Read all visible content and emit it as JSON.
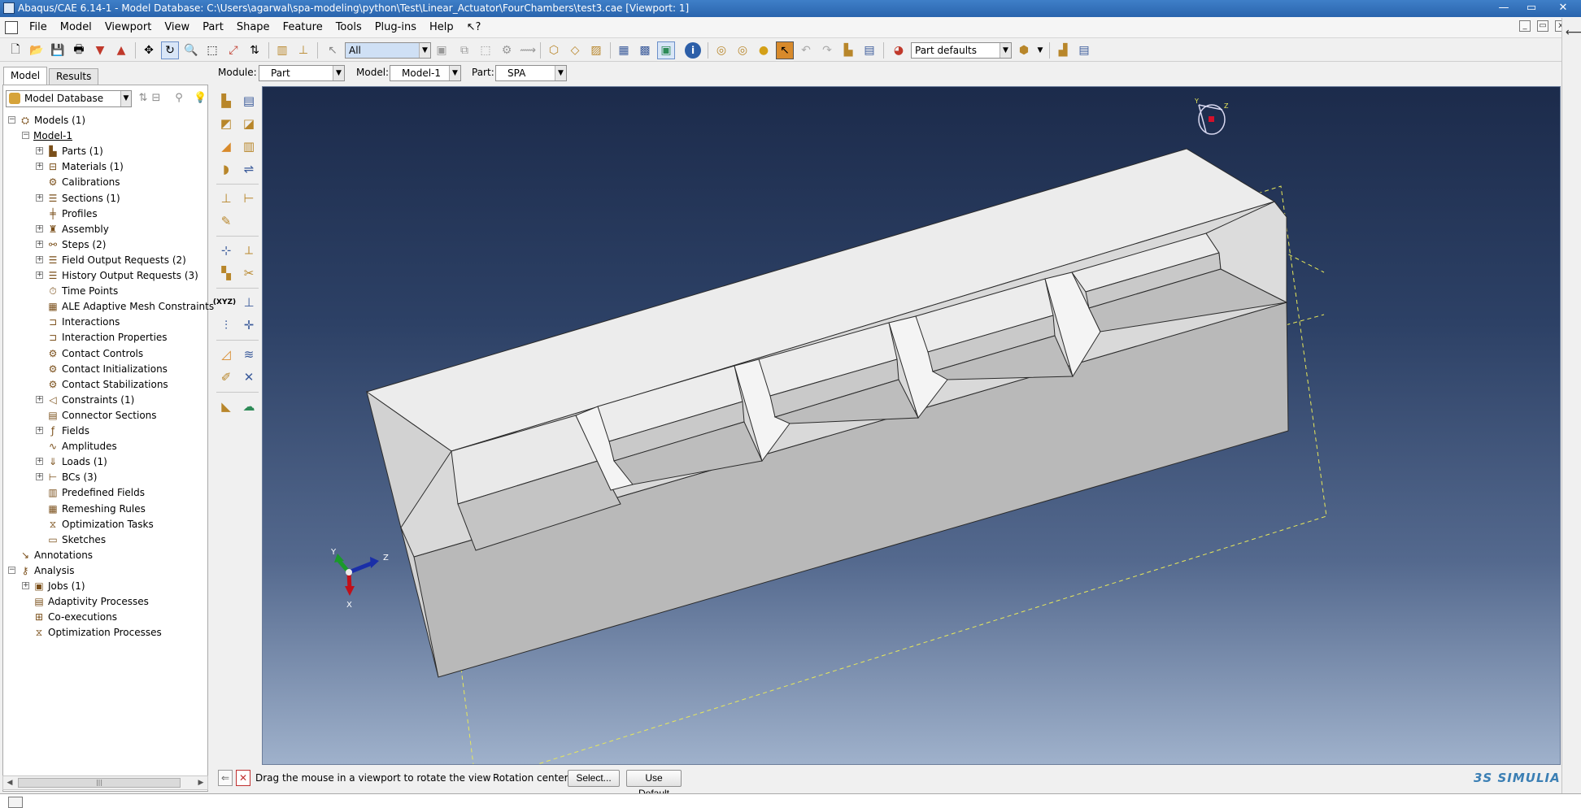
{
  "window": {
    "title": "Abaqus/CAE 6.14-1 - Model Database: C:\\Users\\agarwal\\spa-modeling\\python\\Test\\Linear_Actuator\\FourChambers\\test3.cae [Viewport: 1]",
    "controls": [
      "—",
      "▭",
      "✕"
    ]
  },
  "menu": [
    {
      "label": "File",
      "underline": "F"
    },
    {
      "label": "Model",
      "underline": "M"
    },
    {
      "label": "Viewport",
      "underline": "V"
    },
    {
      "label": "View",
      "underline": "V"
    },
    {
      "label": "Part",
      "underline": "P"
    },
    {
      "label": "Shape",
      "underline": "S"
    },
    {
      "label": "Feature",
      "underline": "F"
    },
    {
      "label": "Tools",
      "underline": "T"
    },
    {
      "label": "Plug-ins",
      "underline": "P"
    },
    {
      "label": "Help",
      "underline": "H"
    },
    {
      "label": "↖?",
      "underline": ""
    }
  ],
  "toolbar": {
    "selection_filter": "All",
    "render_style": "Part defaults"
  },
  "tabs": {
    "model": "Model",
    "results": "Results"
  },
  "context": {
    "module_label": "Module:",
    "module_value": "Part",
    "model_label": "Model:",
    "model_value": "Model-1",
    "part_label": "Part:",
    "part_value": "SPA"
  },
  "tree_header": "Model Database",
  "tree": [
    {
      "label": "Models (1)",
      "level": 0,
      "expander": "minus",
      "icon": "models-icon"
    },
    {
      "label": "Model-1",
      "level": 1,
      "expander": "minus",
      "icon": "",
      "underline": true
    },
    {
      "label": "Parts (1)",
      "level": 2,
      "expander": "plus",
      "icon": "parts-icon"
    },
    {
      "label": "Materials (1)",
      "level": 2,
      "expander": "plus",
      "icon": "materials-icon"
    },
    {
      "label": "Calibrations",
      "level": 2,
      "expander": "",
      "icon": "calibrations-icon"
    },
    {
      "label": "Sections (1)",
      "level": 2,
      "expander": "plus",
      "icon": "sections-icon"
    },
    {
      "label": "Profiles",
      "level": 2,
      "expander": "",
      "icon": "profiles-icon"
    },
    {
      "label": "Assembly",
      "level": 2,
      "expander": "plus",
      "icon": "assembly-icon"
    },
    {
      "label": "Steps (2)",
      "level": 2,
      "expander": "plus",
      "icon": "steps-icon"
    },
    {
      "label": "Field Output Requests (2)",
      "level": 2,
      "expander": "plus",
      "icon": "field-output-icon"
    },
    {
      "label": "History Output Requests (3)",
      "level": 2,
      "expander": "plus",
      "icon": "history-output-icon"
    },
    {
      "label": "Time Points",
      "level": 2,
      "expander": "",
      "icon": "time-points-icon"
    },
    {
      "label": "ALE Adaptive Mesh Constraints",
      "level": 2,
      "expander": "",
      "icon": "ale-mesh-icon"
    },
    {
      "label": "Interactions",
      "level": 2,
      "expander": "",
      "icon": "interactions-icon"
    },
    {
      "label": "Interaction Properties",
      "level": 2,
      "expander": "",
      "icon": "interaction-properties-icon"
    },
    {
      "label": "Contact Controls",
      "level": 2,
      "expander": "",
      "icon": "contact-controls-icon"
    },
    {
      "label": "Contact Initializations",
      "level": 2,
      "expander": "",
      "icon": "contact-init-icon"
    },
    {
      "label": "Contact Stabilizations",
      "level": 2,
      "expander": "",
      "icon": "contact-stab-icon"
    },
    {
      "label": "Constraints (1)",
      "level": 2,
      "expander": "plus",
      "icon": "constraints-icon"
    },
    {
      "label": "Connector Sections",
      "level": 2,
      "expander": "",
      "icon": "connector-sections-icon"
    },
    {
      "label": "Fields",
      "level": 2,
      "expander": "plus",
      "icon": "fields-icon"
    },
    {
      "label": "Amplitudes",
      "level": 2,
      "expander": "",
      "icon": "amplitudes-icon"
    },
    {
      "label": "Loads (1)",
      "level": 2,
      "expander": "plus",
      "icon": "loads-icon"
    },
    {
      "label": "BCs (3)",
      "level": 2,
      "expander": "plus",
      "icon": "bcs-icon"
    },
    {
      "label": "Predefined Fields",
      "level": 2,
      "expander": "",
      "icon": "predefined-fields-icon"
    },
    {
      "label": "Remeshing Rules",
      "level": 2,
      "expander": "",
      "icon": "remeshing-icon"
    },
    {
      "label": "Optimization Tasks",
      "level": 2,
      "expander": "",
      "icon": "optimization-tasks-icon"
    },
    {
      "label": "Sketches",
      "level": 2,
      "expander": "",
      "icon": "sketches-icon"
    },
    {
      "label": "Annotations",
      "level": 0,
      "expander": "",
      "icon": "annotations-icon"
    },
    {
      "label": "Analysis",
      "level": 0,
      "expander": "minus",
      "icon": "analysis-icon"
    },
    {
      "label": "Jobs (1)",
      "level": 1,
      "expander": "plus",
      "icon": "jobs-icon"
    },
    {
      "label": "Adaptivity Processes",
      "level": 1,
      "expander": "",
      "icon": "adaptivity-icon"
    },
    {
      "label": "Co-executions",
      "level": 1,
      "expander": "",
      "icon": "co-executions-icon"
    },
    {
      "label": "Optimization Processes",
      "level": 1,
      "expander": "",
      "icon": "optimization-processes-icon"
    }
  ],
  "prompt": {
    "message": "Drag the mouse in a viewport to rotate the view",
    "rotation_label": "Rotation center:",
    "select_button": "Select...",
    "default_button": "Use Default"
  },
  "triad": {
    "x": "X",
    "y": "Y",
    "z": "Z"
  },
  "compass": {
    "y": "Y",
    "z": "Z"
  },
  "brand": "3S SIMULIA",
  "colors": {
    "title_bar": "#2a64ad",
    "viewport_top": "#1c2b4b",
    "viewport_bottom": "#9fb1cb",
    "part_face_light": "#ececec",
    "part_face_shade": "#b9b9b9",
    "datum_dashes": "#e8e85a"
  }
}
